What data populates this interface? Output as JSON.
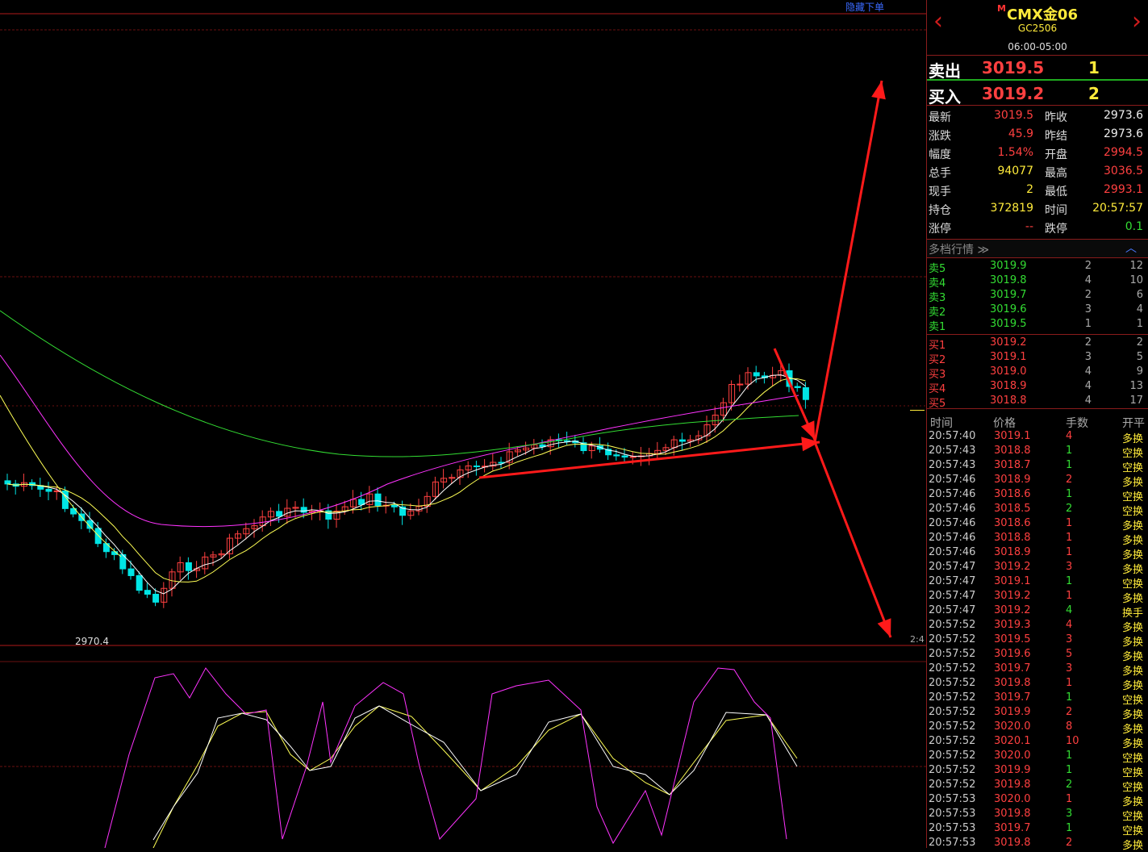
{
  "toolbar": {
    "hide_order": "隐藏下单"
  },
  "chart": {
    "low_label": "2970.4",
    "scale_label": "2:4"
  },
  "instrument": {
    "logo_mark": "M",
    "name": "CMX金06",
    "code": "GC2506",
    "session": "06:00-05:00"
  },
  "ask": {
    "label": "卖出",
    "price": "3019.5",
    "qty": "1"
  },
  "bid": {
    "label": "买入",
    "price": "3019.2",
    "qty": "2"
  },
  "stats": [
    {
      "k1": "最新",
      "v1": "3019.5",
      "c1": "red",
      "k2": "昨收",
      "v2": "2973.6",
      "c2": "wht"
    },
    {
      "k1": "涨跌",
      "v1": "45.9",
      "c1": "red",
      "k2": "昨结",
      "v2": "2973.6",
      "c2": "wht"
    },
    {
      "k1": "幅度",
      "v1": "1.54%",
      "c1": "red",
      "k2": "开盘",
      "v2": "2994.5",
      "c2": "red"
    },
    {
      "k1": "总手",
      "v1": "94077",
      "c1": "yel",
      "k2": "最高",
      "v2": "3036.5",
      "c2": "red"
    },
    {
      "k1": "现手",
      "v1": "2",
      "c1": "yel",
      "k2": "最低",
      "v2": "2993.1",
      "c2": "red"
    },
    {
      "k1": "持仓",
      "v1": "372819",
      "c1": "yel",
      "k2": "时间",
      "v2": "20:57:57",
      "c2": "yel"
    },
    {
      "k1": "涨停",
      "v1": "--",
      "c1": "red",
      "k2": "跌停",
      "v2": "0.1",
      "c2": "grn"
    }
  ],
  "depth": {
    "title": "多档行情 ≫",
    "collapse": "︿"
  },
  "asks": [
    {
      "label": "卖5",
      "price": "3019.9",
      "a": "2",
      "c": "12"
    },
    {
      "label": "卖4",
      "price": "3019.8",
      "a": "4",
      "c": "10"
    },
    {
      "label": "卖3",
      "price": "3019.7",
      "a": "2",
      "c": "6"
    },
    {
      "label": "卖2",
      "price": "3019.6",
      "a": "3",
      "c": "4"
    },
    {
      "label": "卖1",
      "price": "3019.5",
      "a": "1",
      "c": "1"
    }
  ],
  "bids": [
    {
      "label": "买1",
      "price": "3019.2",
      "a": "2",
      "c": "2"
    },
    {
      "label": "买2",
      "price": "3019.1",
      "a": "3",
      "c": "5"
    },
    {
      "label": "买3",
      "price": "3019.0",
      "a": "4",
      "c": "9"
    },
    {
      "label": "买4",
      "price": "3018.9",
      "a": "4",
      "c": "13"
    },
    {
      "label": "买5",
      "price": "3018.8",
      "a": "4",
      "c": "17"
    }
  ],
  "ticks_header": {
    "time": "时间",
    "price": "价格",
    "vol": "手数",
    "open": "开平"
  },
  "ticks": [
    {
      "t": "20:57:40",
      "p": "3019.1",
      "v": "4",
      "o": "多换",
      "vc": "red"
    },
    {
      "t": "20:57:43",
      "p": "3018.8",
      "v": "1",
      "o": "空换",
      "vc": "grn"
    },
    {
      "t": "20:57:43",
      "p": "3018.7",
      "v": "1",
      "o": "空换",
      "vc": "grn"
    },
    {
      "t": "20:57:46",
      "p": "3018.9",
      "v": "2",
      "o": "多换",
      "vc": "red"
    },
    {
      "t": "20:57:46",
      "p": "3018.6",
      "v": "1",
      "o": "空换",
      "vc": "grn"
    },
    {
      "t": "20:57:46",
      "p": "3018.5",
      "v": "2",
      "o": "空换",
      "vc": "grn"
    },
    {
      "t": "20:57:46",
      "p": "3018.6",
      "v": "1",
      "o": "多换",
      "vc": "red"
    },
    {
      "t": "20:57:46",
      "p": "3018.8",
      "v": "1",
      "o": "多换",
      "vc": "red"
    },
    {
      "t": "20:57:46",
      "p": "3018.9",
      "v": "1",
      "o": "多换",
      "vc": "red"
    },
    {
      "t": "20:57:47",
      "p": "3019.2",
      "v": "3",
      "o": "多换",
      "vc": "red"
    },
    {
      "t": "20:57:47",
      "p": "3019.1",
      "v": "1",
      "o": "空换",
      "vc": "grn"
    },
    {
      "t": "20:57:47",
      "p": "3019.2",
      "v": "1",
      "o": "多换",
      "vc": "red"
    },
    {
      "t": "20:57:47",
      "p": "3019.2",
      "v": "4",
      "o": "换手",
      "vc": "grn"
    },
    {
      "t": "20:57:52",
      "p": "3019.3",
      "v": "4",
      "o": "多换",
      "vc": "red"
    },
    {
      "t": "20:57:52",
      "p": "3019.5",
      "v": "3",
      "o": "多换",
      "vc": "red"
    },
    {
      "t": "20:57:52",
      "p": "3019.6",
      "v": "5",
      "o": "多换",
      "vc": "red"
    },
    {
      "t": "20:57:52",
      "p": "3019.7",
      "v": "3",
      "o": "多换",
      "vc": "red"
    },
    {
      "t": "20:57:52",
      "p": "3019.8",
      "v": "1",
      "o": "多换",
      "vc": "red"
    },
    {
      "t": "20:57:52",
      "p": "3019.7",
      "v": "1",
      "o": "空换",
      "vc": "grn"
    },
    {
      "t": "20:57:52",
      "p": "3019.9",
      "v": "2",
      "o": "多换",
      "vc": "red"
    },
    {
      "t": "20:57:52",
      "p": "3020.0",
      "v": "8",
      "o": "多换",
      "vc": "red"
    },
    {
      "t": "20:57:52",
      "p": "3020.1",
      "v": "10",
      "o": "多换",
      "vc": "red"
    },
    {
      "t": "20:57:52",
      "p": "3020.0",
      "v": "1",
      "o": "空换",
      "vc": "grn"
    },
    {
      "t": "20:57:52",
      "p": "3019.9",
      "v": "1",
      "o": "空换",
      "vc": "grn"
    },
    {
      "t": "20:57:52",
      "p": "3019.8",
      "v": "2",
      "o": "空换",
      "vc": "grn"
    },
    {
      "t": "20:57:53",
      "p": "3020.0",
      "v": "1",
      "o": "多换",
      "vc": "red"
    },
    {
      "t": "20:57:53",
      "p": "3019.8",
      "v": "3",
      "o": "空换",
      "vc": "grn"
    },
    {
      "t": "20:57:53",
      "p": "3019.7",
      "v": "1",
      "o": "空换",
      "vc": "grn"
    },
    {
      "t": "20:57:53",
      "p": "3019.8",
      "v": "2",
      "o": "多换",
      "vc": "red"
    }
  ],
  "colors": {
    "up": "#ff4040",
    "down": "#00e5e5",
    "ma5": "#ffffff",
    "ma10": "#ffff55",
    "ma20": "#ff33ff",
    "ma60": "#33dd33",
    "grid": "#6a1010",
    "arrow": "#ff1a1a"
  }
}
